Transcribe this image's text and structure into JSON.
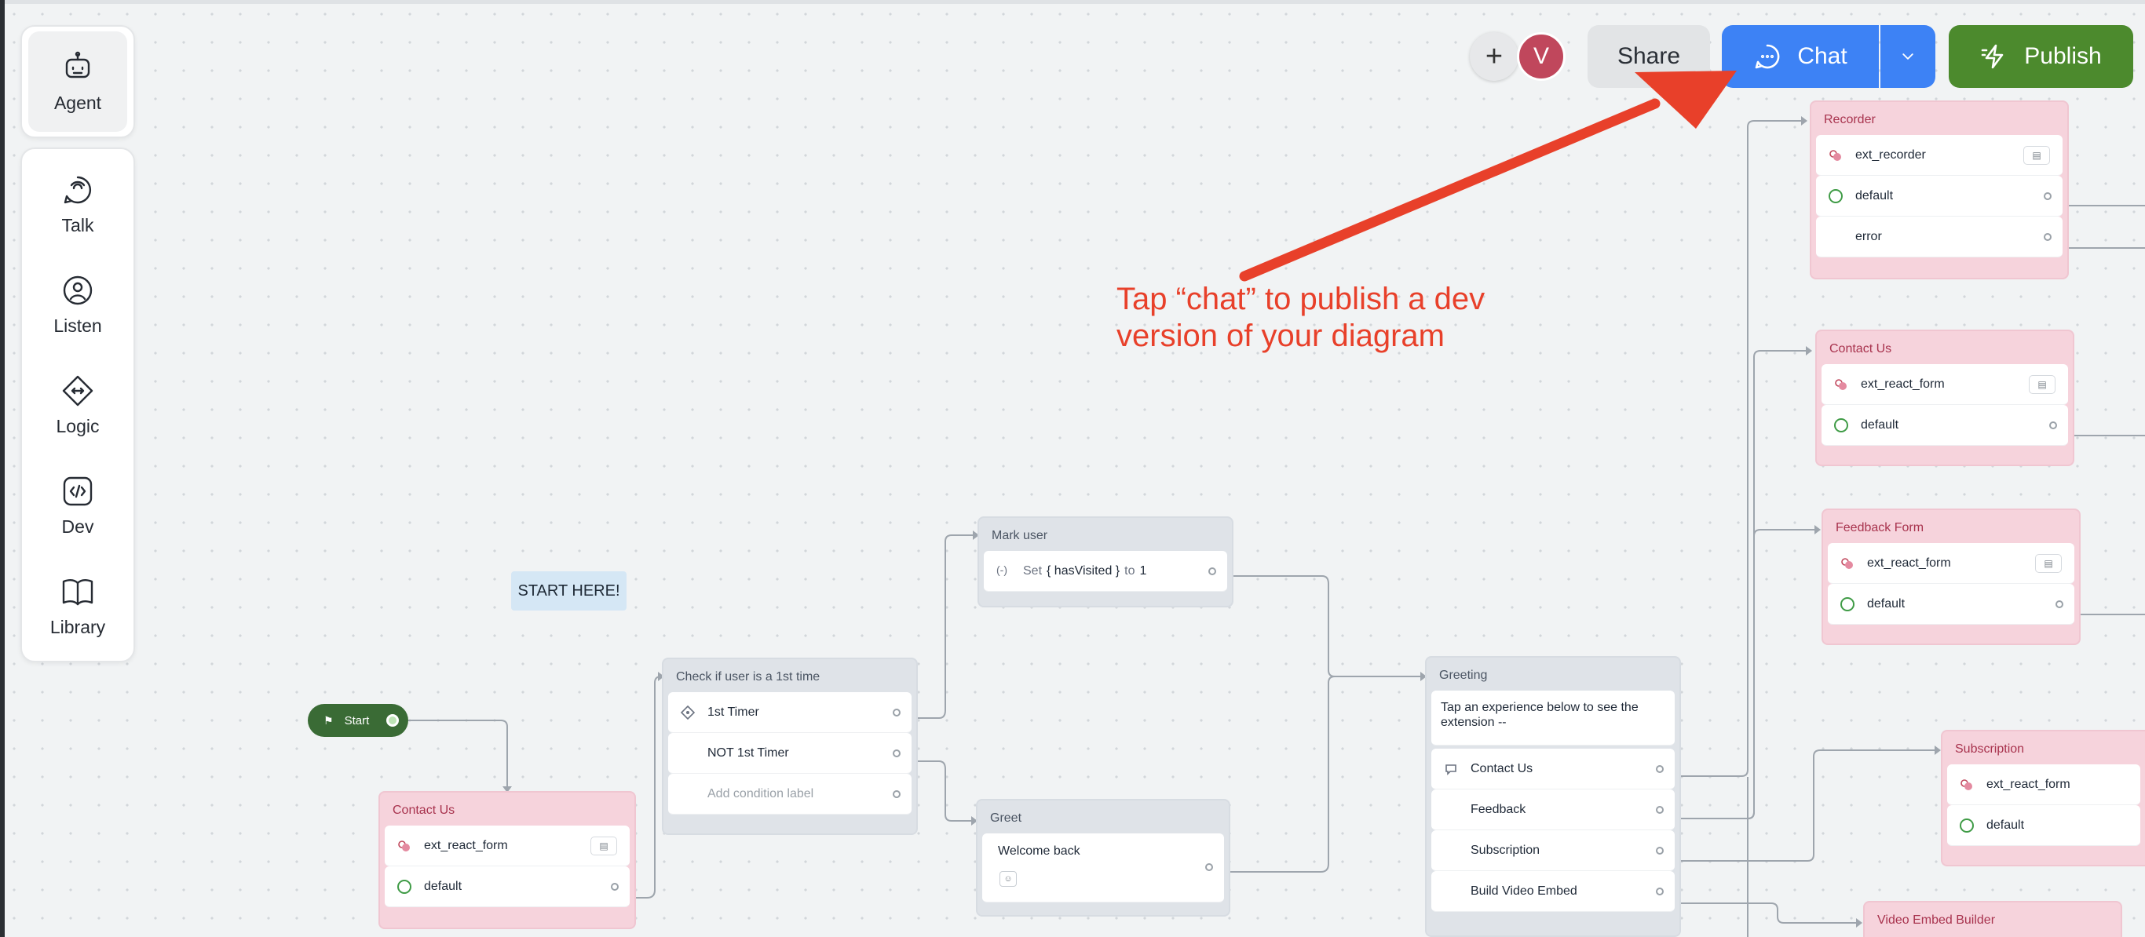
{
  "sidebar": {
    "items": [
      {
        "label": "Agent",
        "icon": "robot-icon"
      },
      {
        "label": "Talk",
        "icon": "talk-icon"
      },
      {
        "label": "Listen",
        "icon": "listen-icon"
      },
      {
        "label": "Logic",
        "icon": "logic-icon"
      },
      {
        "label": "Dev",
        "icon": "code-icon"
      },
      {
        "label": "Library",
        "icon": "book-icon"
      }
    ]
  },
  "topbar": {
    "plus": "+",
    "avatar_initial": "V",
    "share_label": "Share",
    "chat_label": "Chat",
    "publish_label": "Publish"
  },
  "canvas": {
    "start_label": "Start",
    "start_here_note": "START HERE!",
    "annotation": "Tap “chat” to publish a dev version of your diagram",
    "blocks": {
      "contact_bottom": {
        "title": "Contact Us",
        "ext": "ext_react_form",
        "default": "default"
      },
      "check": {
        "title": "Check if user is a 1st time",
        "cond1": "1st Timer",
        "cond2": "NOT 1st Timer",
        "add": "Add condition label"
      },
      "mark": {
        "title": "Mark user",
        "set_prefix": "Set",
        "set_var": "{ hasVisited }",
        "set_to": "to",
        "set_val": "1"
      },
      "greet": {
        "title": "Greet",
        "text": "Welcome back"
      },
      "greeting": {
        "title": "Greeting",
        "text": "Tap an experience below to see the extension --",
        "choices": [
          "Contact Us",
          "Feedback",
          "Subscription",
          "Build Video Embed"
        ]
      },
      "recorder": {
        "title": "Recorder",
        "ext": "ext_recorder",
        "default": "default",
        "error": "error"
      },
      "contact_right": {
        "title": "Contact Us",
        "ext": "ext_react_form",
        "default": "default"
      },
      "feedback": {
        "title": "Feedback Form",
        "ext": "ext_react_form",
        "default": "default"
      },
      "subscription": {
        "title": "Subscription",
        "ext": "ext_react_form",
        "default": "default"
      },
      "video": {
        "title": "Video Embed Builder"
      }
    }
  },
  "colors": {
    "chat_blue": "#3d82f5",
    "publish_green": "#4c8a2d",
    "annotation_red": "#e8402a",
    "extension_block_pink": "#f6d3dc",
    "avatar_red": "#c0475c"
  }
}
